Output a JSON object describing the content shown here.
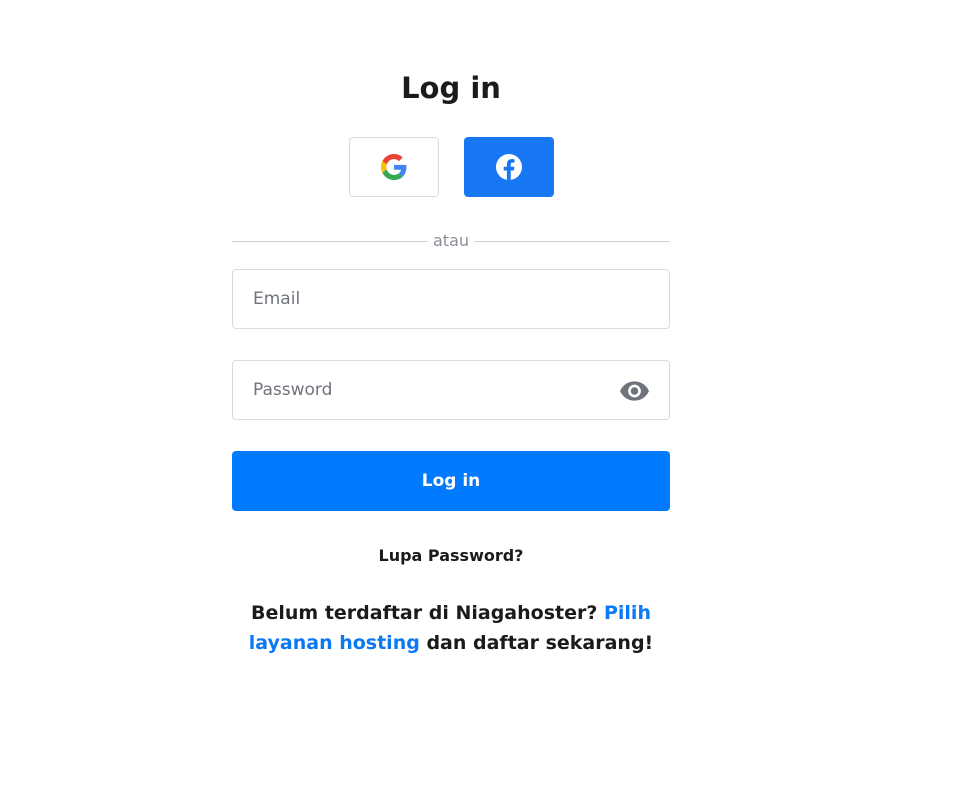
{
  "login": {
    "title": "Log in",
    "social": {
      "google_icon": "google-icon",
      "facebook_icon": "facebook-icon"
    },
    "divider_text": "atau",
    "email": {
      "placeholder": "Email",
      "value": ""
    },
    "password": {
      "placeholder": "Password",
      "value": "",
      "toggle_icon": "eye-icon"
    },
    "submit_label": "Log in",
    "forgot_password": "Lupa Password?",
    "signup": {
      "prefix": "Belum terdaftar di Niagahoster? ",
      "link_text": "Pilih layanan hosting",
      "suffix": " dan daftar sekarang!"
    }
  },
  "colors": {
    "primary": "#007aff",
    "facebook": "#1877f2",
    "link": "#0b78f4",
    "text": "#1b1b1b",
    "border": "#d9dbe0"
  }
}
